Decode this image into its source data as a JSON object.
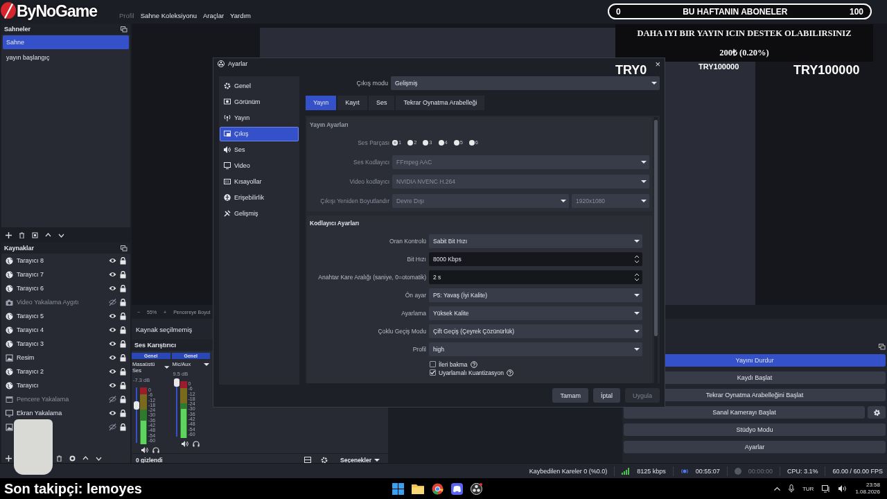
{
  "overlay": {
    "logo": "ByNoGame",
    "subs_bar": {
      "min": "0",
      "title": "BU HAFTANIN ABONELER",
      "max": "100"
    },
    "donation": {
      "headline": "DAHA IYI BIR YAYIN ICIN DESTEK OLABILIRSINIZ",
      "amount": "200₺ (0.20%)"
    },
    "goal_current": "TRY0",
    "goal_small": "TRY100000",
    "goal_target": "TRY100000"
  },
  "menu": [
    {
      "label": "Profil",
      "disabled": true
    },
    {
      "label": "Sahne Koleksiyonu",
      "disabled": false
    },
    {
      "label": "Araçlar",
      "disabled": false
    },
    {
      "label": "Yardım",
      "disabled": false
    }
  ],
  "scenes": {
    "title": "Sahneler",
    "items": [
      {
        "label": "Sahne",
        "selected": true
      },
      {
        "label": "yayın başlangıç",
        "selected": false
      }
    ]
  },
  "sources": {
    "title": "Kaynaklar",
    "items": [
      {
        "label": "Tarayıcı 8",
        "kind": "browser",
        "visible": true,
        "locked": true
      },
      {
        "label": "Tarayıcı 7",
        "kind": "browser",
        "visible": true,
        "locked": true
      },
      {
        "label": "Tarayıcı 6",
        "kind": "browser",
        "visible": true,
        "locked": true
      },
      {
        "label": "Video Yakalama Aygıtı",
        "kind": "camera",
        "visible": false,
        "locked": true
      },
      {
        "label": "Tarayıcı 5",
        "kind": "browser",
        "visible": true,
        "locked": true
      },
      {
        "label": "Tarayıcı 4",
        "kind": "browser",
        "visible": true,
        "locked": true
      },
      {
        "label": "Tarayıcı 3",
        "kind": "browser",
        "visible": true,
        "locked": true
      },
      {
        "label": "Resim",
        "kind": "image",
        "visible": true,
        "locked": true
      },
      {
        "label": "Tarayıcı 2",
        "kind": "browser",
        "visible": true,
        "locked": true
      },
      {
        "label": "Tarayıcı",
        "kind": "browser",
        "visible": true,
        "locked": true
      },
      {
        "label": "Pencere Yakalama",
        "kind": "window",
        "visible": false,
        "locked": true
      },
      {
        "label": "Ekran Yakalama",
        "kind": "display",
        "visible": true,
        "locked": true
      },
      {
        "kind": "image",
        "visible": false,
        "locked": true
      }
    ]
  },
  "preview": {
    "zoom_out": "−",
    "zoom": "55%",
    "zoom_in": "+",
    "fit_label": "Pencereye Boyut"
  },
  "properties_hint": "Kaynak seçilmemiş",
  "mixer": {
    "title": "Ses Karıştırıcı",
    "channels": [
      {
        "tag": "Genel",
        "name": "Masaüstü Ses",
        "reading": "-7.3 dB",
        "level": 0.68,
        "scale": [
          "0",
          "-6",
          "-12",
          "-18",
          "-24",
          "-30",
          "-36",
          "-42",
          "-48",
          "-54",
          "-60"
        ]
      },
      {
        "tag": "Genel",
        "name": "Mic/Aux",
        "reading": "9.5 dB",
        "level": 0.97,
        "scale": [
          "0",
          "-6",
          "-12",
          "-18",
          "-24",
          "-30",
          "-36",
          "-42",
          "-48",
          "-54",
          "-60"
        ]
      }
    ],
    "hidden_count": "0 gizlendi",
    "options": "Seçenekler"
  },
  "controls": [
    {
      "label": "Yayını Durdur",
      "kind": "active"
    },
    {
      "label": "Kaydı Başlat",
      "kind": "plain"
    },
    {
      "label": "Tekrar Oynatma Arabelleğini Başlat",
      "kind": "plain"
    },
    {
      "label": "Sanal Kamerayı Başlat",
      "kind": "gear"
    },
    {
      "label": "Stüdyo Modu",
      "kind": "plain"
    },
    {
      "label": "Ayarlar",
      "kind": "plain"
    }
  ],
  "status_bar": {
    "dropped": "Kaybedilen Kareler 0 (%0.0)",
    "bitrate": "8125 kbps",
    "stream_time": "00:55:07",
    "record_time": "00:00:00",
    "cpu": "CPU: 3.1%",
    "fps": "60.00 / 60.00 FPS"
  },
  "taskbar": {
    "last_follower": "Son takipçi: lemoyes",
    "lang": "TUR",
    "time": "23:58",
    "date": "1.08.2026"
  },
  "settings": {
    "title": "Ayarlar",
    "close": "×",
    "nav": [
      {
        "label": "Genel",
        "selected": false
      },
      {
        "label": "Görünüm",
        "selected": false
      },
      {
        "label": "Yayın",
        "selected": false
      },
      {
        "label": "Çıkış",
        "selected": true
      },
      {
        "label": "Ses",
        "selected": false
      },
      {
        "label": "Video",
        "selected": false
      },
      {
        "label": "Kısayollar",
        "selected": false
      },
      {
        "label": "Erişebilirlik",
        "selected": false
      },
      {
        "label": "Gelişmiş",
        "selected": false
      }
    ],
    "output_mode": {
      "label": "Çıkış modu",
      "value": "Gelişmiş"
    },
    "tabs": [
      {
        "label": "Yayın",
        "selected": true
      },
      {
        "label": "Kayıt",
        "selected": false
      },
      {
        "label": "Ses",
        "selected": false
      },
      {
        "label": "Tekrar Oynatma Arabelleği",
        "selected": false
      }
    ],
    "stream_section": {
      "title": "Yayın Ayarları",
      "disabled": true,
      "tracks_label": "Ses Parçası",
      "tracks": [
        {
          "label": "1",
          "selected": true
        },
        {
          "label": "2",
          "selected": false
        },
        {
          "label": "3",
          "selected": false
        },
        {
          "label": "4",
          "selected": false
        },
        {
          "label": "5",
          "selected": false
        },
        {
          "label": "6",
          "selected": false
        }
      ],
      "fields": [
        {
          "label": "Ses Kodlayıcı",
          "value": "FFmpeg AAC"
        },
        {
          "label": "Video kodlayıcı",
          "value": "NVIDIA NVENC H.264"
        },
        {
          "label": "Çıkışı Yeniden Boyutlandır",
          "value": "Devre Dışı",
          "value2": "1920x1080"
        }
      ]
    },
    "encoder_section": {
      "title": "Kodlayıcı Ayarları",
      "fields": [
        {
          "label": "Oran Kontrolü",
          "value": "Sabit Bit Hızı",
          "kind": "select"
        },
        {
          "label": "Bit Hızı",
          "value": "8000 Kbps",
          "kind": "spin"
        },
        {
          "label": "Anahtar Kare Aralığı (saniye, 0=otomatik)",
          "value": "2 s",
          "kind": "spin"
        },
        {
          "label": "Ön ayar",
          "value": "P5: Yavaş (İyi Kalite)",
          "kind": "select"
        },
        {
          "label": "Ayarlama",
          "value": "Yüksek Kalite",
          "kind": "select"
        },
        {
          "label": "Çoklu Geçiş Modu",
          "value": "Çift Geçiş (Çeyrek Çözünürlük)",
          "kind": "select"
        },
        {
          "label": "Profil",
          "value": "high",
          "kind": "select"
        }
      ],
      "checks": [
        {
          "label": "İleri bakma",
          "checked": false
        },
        {
          "label": "Uyarlamalı Kuantizasyon",
          "checked": true
        }
      ]
    },
    "buttons": [
      {
        "label": "Tamam",
        "disabled": false
      },
      {
        "label": "İptal",
        "disabled": false
      },
      {
        "label": "Uygula",
        "disabled": true
      }
    ]
  }
}
